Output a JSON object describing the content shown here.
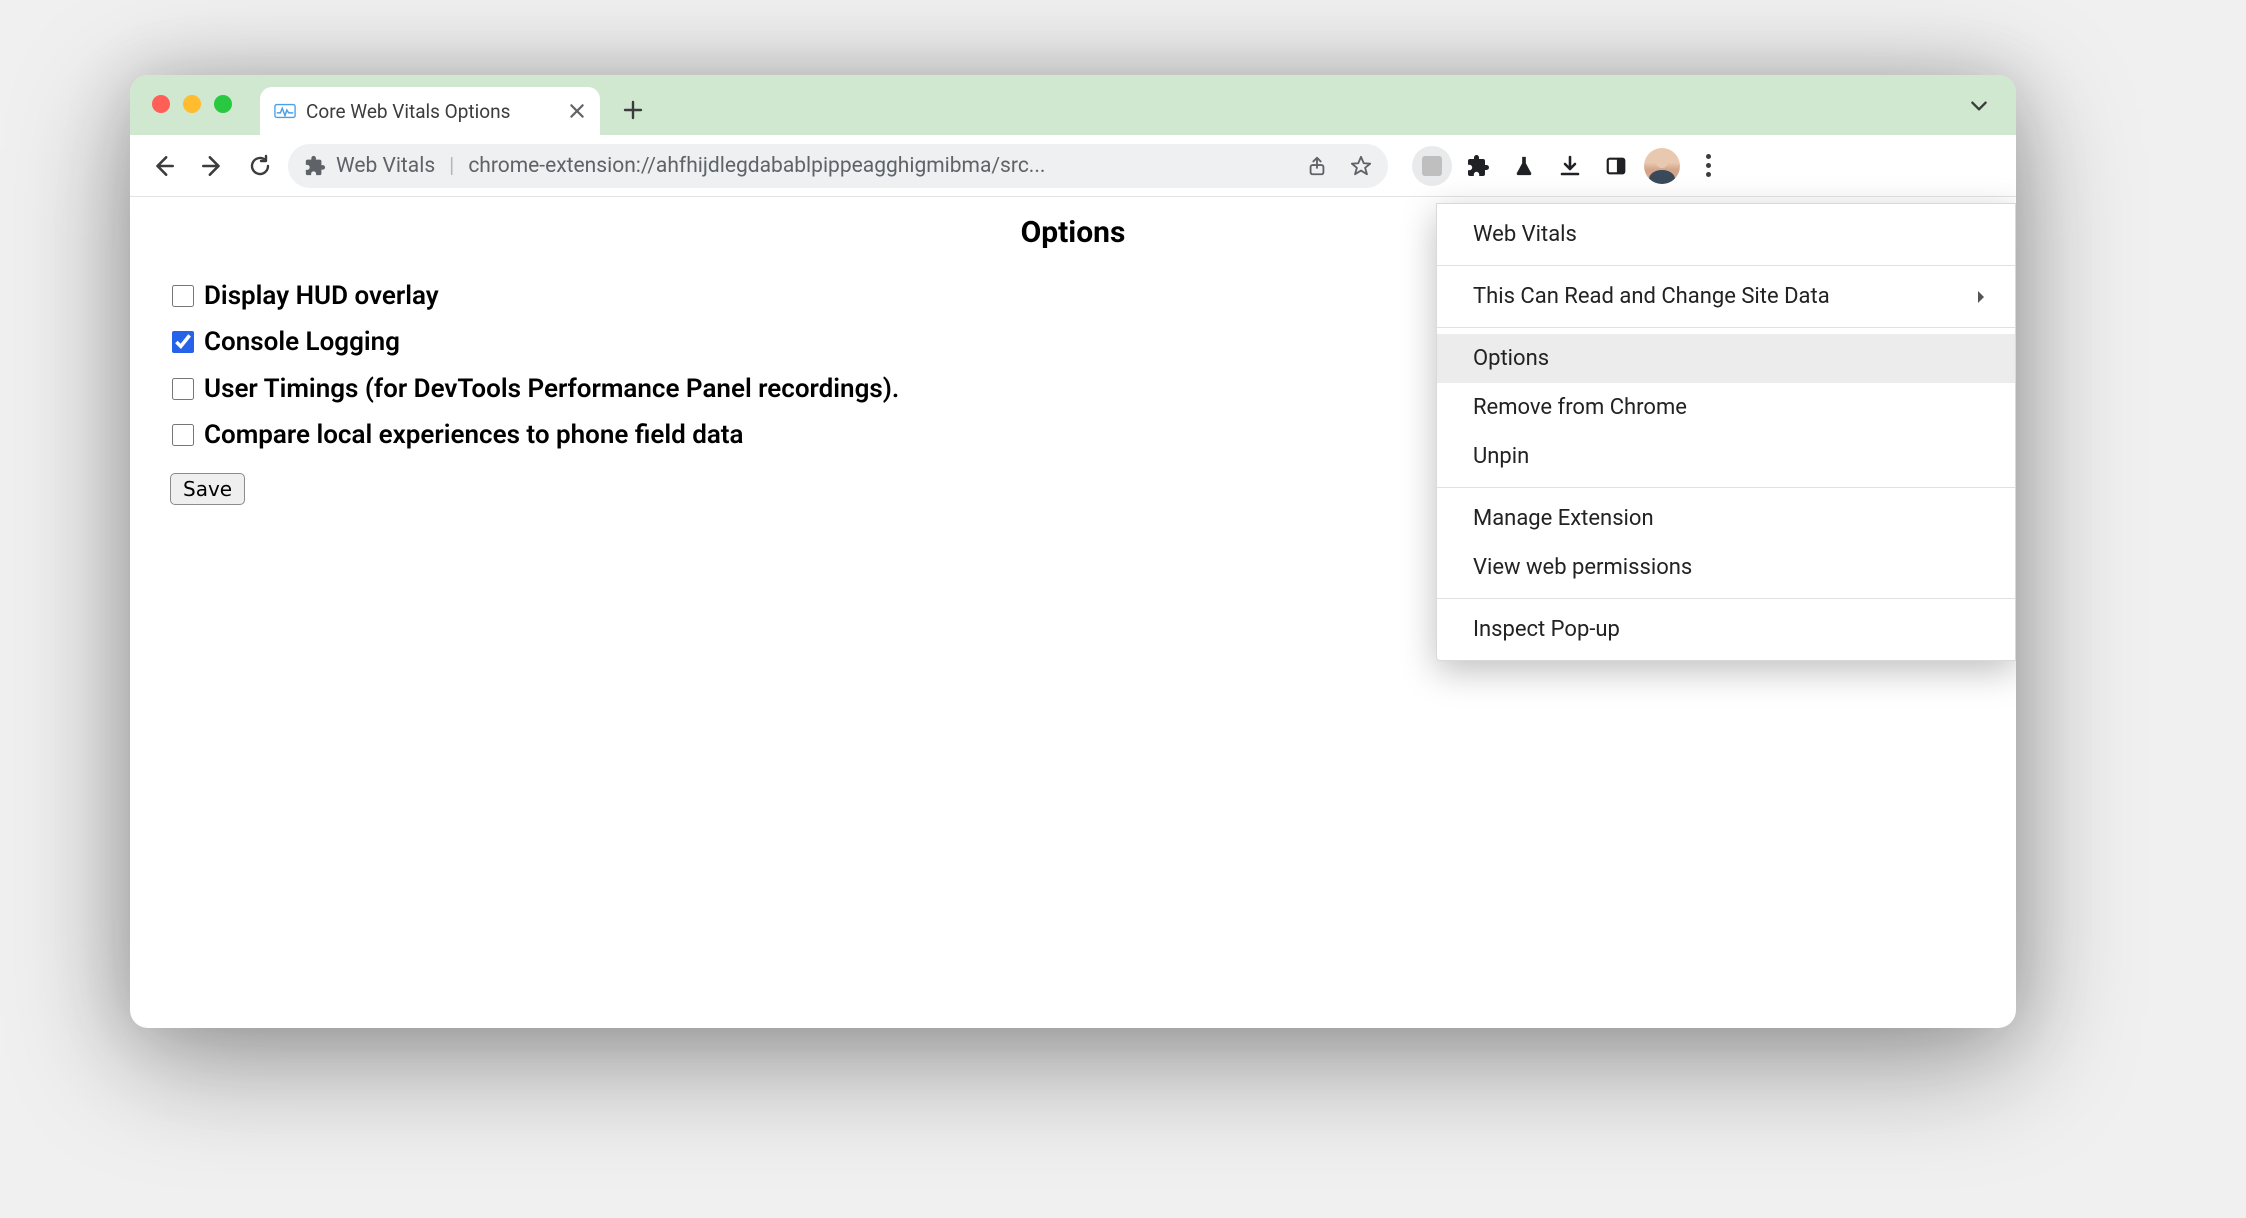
{
  "tab": {
    "title": "Core Web Vitals Options"
  },
  "omnibox": {
    "extension_name": "Web Vitals",
    "url_display": "chrome-extension://ahfhijdlegdabablpippeagghigmibma/src..."
  },
  "page": {
    "heading": "Options",
    "options": [
      {
        "label": "Display HUD overlay",
        "checked": false
      },
      {
        "label": "Console Logging",
        "checked": true
      },
      {
        "label": "User Timings (for DevTools Performance Panel recordings).",
        "checked": false
      },
      {
        "label": "Compare local experiences to phone field data",
        "checked": false
      }
    ],
    "save_label": "Save"
  },
  "context_menu": {
    "groups": [
      [
        {
          "label": "Web Vitals",
          "submenu": false,
          "hover": false
        }
      ],
      [
        {
          "label": "This Can Read and Change Site Data",
          "submenu": true,
          "hover": false
        }
      ],
      [
        {
          "label": "Options",
          "submenu": false,
          "hover": true
        },
        {
          "label": "Remove from Chrome",
          "submenu": false,
          "hover": false
        },
        {
          "label": "Unpin",
          "submenu": false,
          "hover": false
        }
      ],
      [
        {
          "label": "Manage Extension",
          "submenu": false,
          "hover": false
        },
        {
          "label": "View web permissions",
          "submenu": false,
          "hover": false
        }
      ],
      [
        {
          "label": "Inspect Pop-up",
          "submenu": false,
          "hover": false
        }
      ]
    ]
  }
}
